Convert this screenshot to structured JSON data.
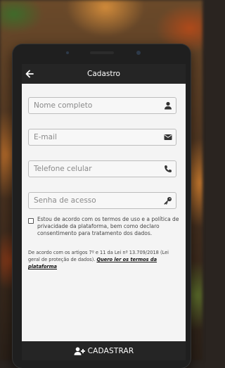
{
  "header": {
    "title": "Cadastro"
  },
  "form": {
    "name_placeholder": "Nome completo",
    "email_placeholder": "E-mail",
    "phone_placeholder": "Telefone celular",
    "password_placeholder": "Senha de acesso"
  },
  "terms": {
    "label": "Estou de acordo com os termos de uso e a política de privacidade da plataforma, bem como declaro consentimento para tratamento dos dados.",
    "checked": false
  },
  "lgpd": {
    "text": "De acordo com os artigos 7º e 11 da Lei nº 13.709/2018 (Lei geral de proteção de dados).",
    "link": "Quero ler os termos da plataforma"
  },
  "submit": {
    "label": "CADASTRAR"
  },
  "colors": {
    "bar": "#252525",
    "screen": "#f4f4f4",
    "border": "#bdbdbd"
  },
  "icons": [
    "back-arrow-icon",
    "user-icon",
    "envelope-icon",
    "phone-icon",
    "key-icon",
    "user-plus-icon"
  ]
}
